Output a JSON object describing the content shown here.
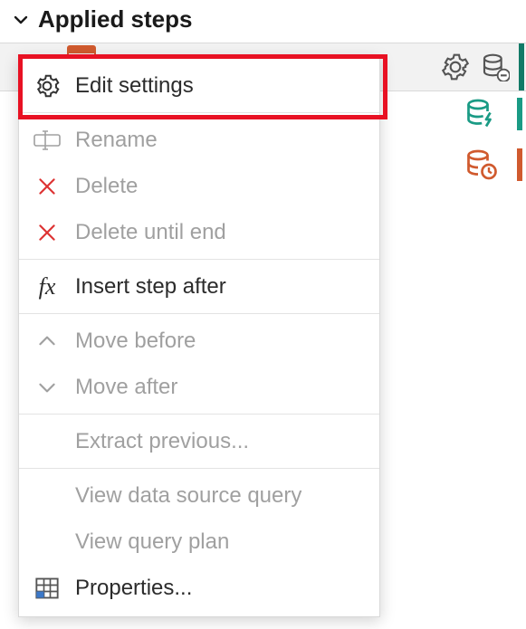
{
  "header": {
    "title": "Applied steps"
  },
  "menu": {
    "edit_settings": "Edit settings",
    "rename": "Rename",
    "delete": "Delete",
    "delete_until_end": "Delete until end",
    "insert_step_after": "Insert step after",
    "move_before": "Move before",
    "move_after": "Move after",
    "extract_previous": "Extract previous...",
    "view_data_source_query": "View data source query",
    "view_query_plan": "View query plan",
    "properties": "Properties..."
  },
  "icons": {
    "chevron_down": "chevron-down-icon",
    "gear": "gear-icon",
    "db_minus": "database-remove-icon",
    "db_bolt": "database-bolt-icon",
    "db_clock": "database-clock-icon",
    "rename": "rename-icon",
    "x": "x-icon",
    "fx": "fx-icon",
    "up": "chevron-up-icon",
    "down": "chevron-down-small-icon",
    "table": "table-icon"
  },
  "colors": {
    "highlight": "#e81123",
    "teal": "#1a9b85",
    "orange": "#d05a2e",
    "disabled": "#a0a0a0"
  }
}
